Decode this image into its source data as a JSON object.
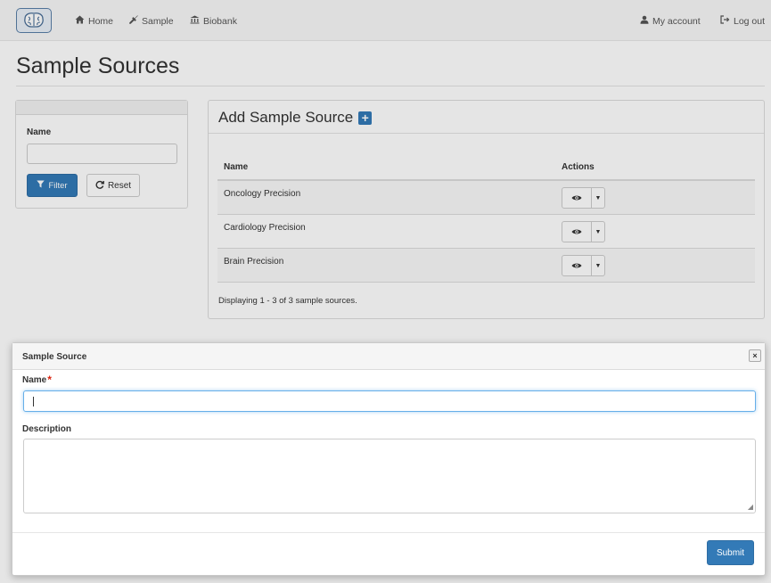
{
  "navbar": {
    "logo_icon": "brain-icon",
    "home_label": "Home",
    "home_icon": "home-icon",
    "sample_label": "Sample",
    "sample_icon": "pipette-icon",
    "biobank_label": "Biobank",
    "biobank_icon": "bank-icon",
    "account_label": "My account",
    "account_icon": "user-icon",
    "logout_label": "Log out",
    "logout_icon": "log-out-icon"
  },
  "page": {
    "title": "Sample Sources"
  },
  "filter": {
    "name_label": "Name",
    "name_value": "",
    "filter_label": "Filter",
    "reset_label": "Reset"
  },
  "main": {
    "add_title": "Add Sample Source",
    "plus_glyph": "+",
    "columns": [
      "Name",
      "Actions"
    ],
    "rows": [
      {
        "name": "Oncology Precision"
      },
      {
        "name": "Cardiology Precision"
      },
      {
        "name": "Brain Precision"
      }
    ],
    "displaying": "Displaying 1 - 3 of 3 sample sources."
  },
  "dialog": {
    "title": "Sample Source",
    "close_glyph": "×",
    "name_label": "Name",
    "required_mark": "*",
    "name_value": "",
    "description_label": "Description",
    "description_value": "",
    "submit_label": "Submit"
  },
  "colors": {
    "primary": "#337ab7",
    "required": "#d9230f",
    "focus": "#66afe9"
  }
}
